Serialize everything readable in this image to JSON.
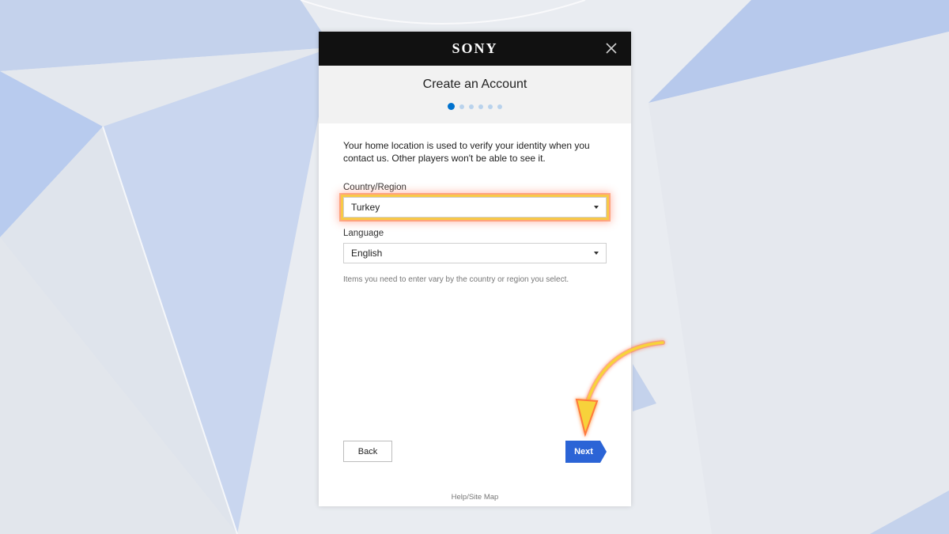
{
  "colors": {
    "topbar": "#111111",
    "accent_blue": "#0072ce",
    "next_button": "#2b64d6",
    "highlight": "#f7c948"
  },
  "dialog": {
    "brand": "SONY",
    "close_icon": "close-icon",
    "title": "Create an Account",
    "progress": {
      "steps": 6,
      "current": 1
    },
    "intro": "Your home location is used to verify your identity when you contact us. Other players won't be able to see it.",
    "country": {
      "label": "Country/Region",
      "value": "Turkey",
      "highlighted": true
    },
    "language": {
      "label": "Language",
      "value": "English"
    },
    "hint": "Items you need to enter vary by the country or region you select.",
    "back_label": "Back",
    "next_label": "Next",
    "footer_link": "Help/Site Map"
  },
  "annotation": {
    "arrow_icon": "curved-arrow-icon",
    "points_to": "Next"
  }
}
